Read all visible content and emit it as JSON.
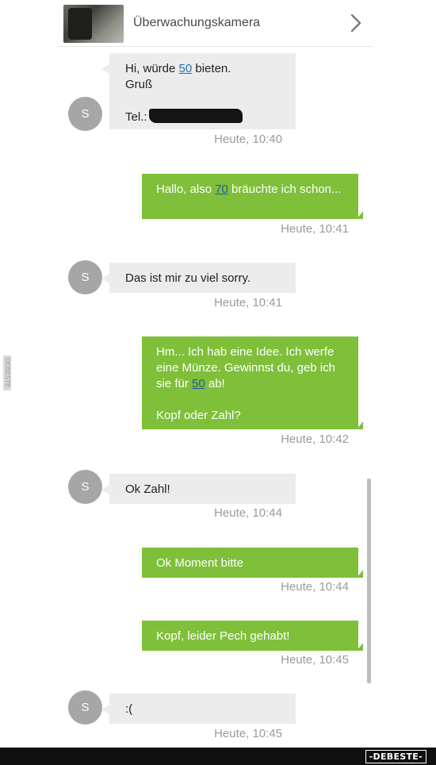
{
  "header": {
    "title": "Überwachungskamera"
  },
  "avatar_letter": "S",
  "messages": [
    {
      "pre": "Hi, würde ",
      "num": "50",
      "post": " bieten.",
      "line2": "Gruß",
      "line3": "Tel.:",
      "time": "Heute, 10:40"
    },
    {
      "pre": "Hallo, also ",
      "num": "70",
      "post": " bräuchte ich schon...",
      "time": "Heute, 10:41"
    },
    {
      "text": "Das ist mir zu viel sorry.",
      "time": "Heute, 10:41"
    },
    {
      "pre": "Hm... Ich hab eine Idee. Ich werfe eine Münze. Gewinnst du, geb ich sie für ",
      "num": "50",
      "post": " ab!",
      "line2": "Kopf oder Zahl?",
      "time": "Heute, 10:42"
    },
    {
      "text": "Ok Zahl!",
      "time": "Heute, 10:44"
    },
    {
      "text": "Ok Moment bitte",
      "time": "Heute, 10:44"
    },
    {
      "text": "Kopf, leider Pech gehabt!",
      "time": "Heute, 10:45"
    },
    {
      "text": ":(",
      "time": "Heute, 10:45"
    }
  ],
  "side_mark": "DEBESTE",
  "watermark": "-DEBESTE-"
}
